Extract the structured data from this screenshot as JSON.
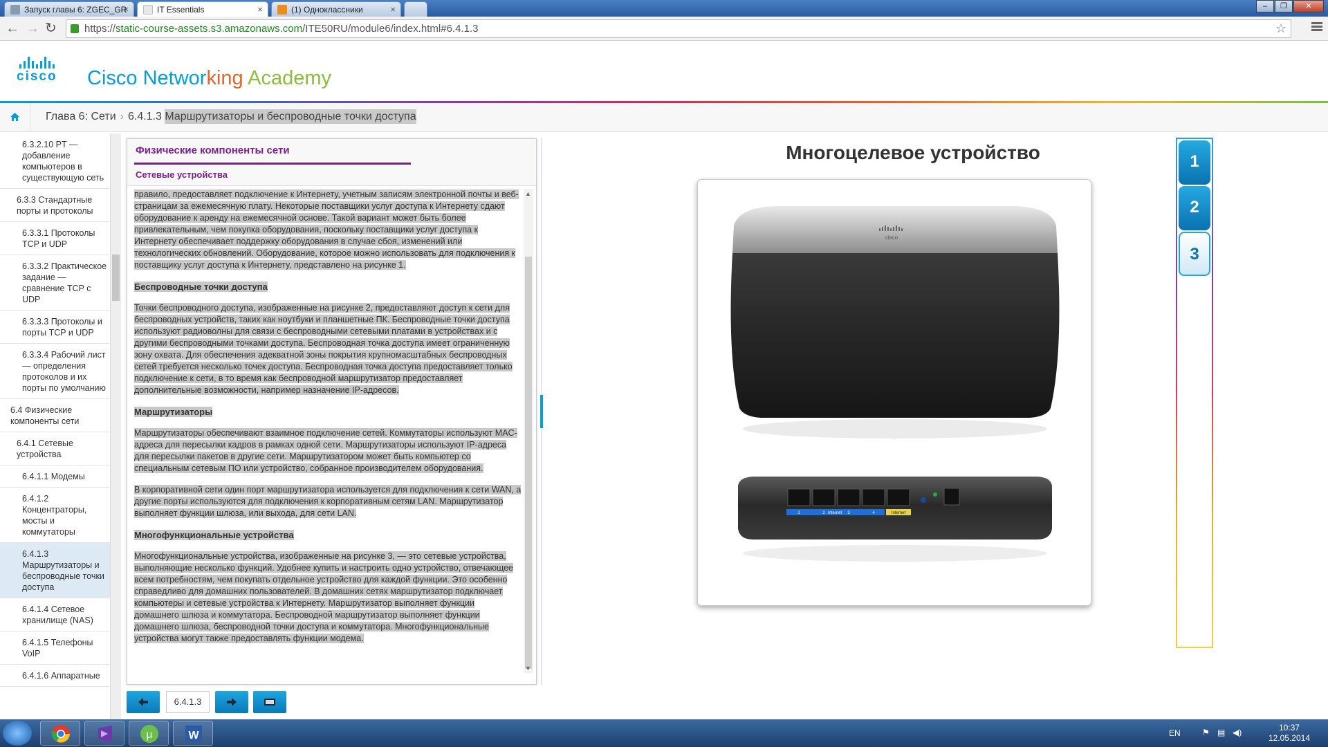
{
  "browser": {
    "tabs": [
      {
        "title": "Запуск главы 6: ZGEC_GR",
        "active": false
      },
      {
        "title": "IT Essentials",
        "active": true
      },
      {
        "title": "(1) Одноклассники",
        "active": false
      }
    ],
    "url_prefix": "https://",
    "url_host": "static-course-assets.s3.amazonaws.com",
    "url_path": "/ITE50RU/module6/index.html#6.4.1.3"
  },
  "header": {
    "logo_word": "cisco",
    "brand": {
      "p1": "Cisco Networ",
      "p2": "king",
      "p3": " Academy"
    }
  },
  "breadcrumb": {
    "chapter": "Глава 6: Сети",
    "page_num": "6.4.1.3",
    "page_title": "Маршрутизаторы и беспроводные точки доступа"
  },
  "toc": [
    {
      "label": "6.3.2.10 PT — добавление компьютеров в существующую сеть",
      "level": 3
    },
    {
      "label": "6.3.3 Стандартные порты и протоколы",
      "level": 2
    },
    {
      "label": "6.3.3.1 Протоколы TCP и UDP",
      "level": 3
    },
    {
      "label": "6.3.3.2 Практическое задание — сравнение TCP с UDP",
      "level": 3
    },
    {
      "label": "6.3.3.3 Протоколы и порты TCP и UDP",
      "level": 3
    },
    {
      "label": "6.3.3.4 Рабочий лист — определения протоколов и их порты по умолчанию",
      "level": 3
    },
    {
      "label": "6.4 Физические компоненты сети",
      "level": 1
    },
    {
      "label": "6.4.1 Сетевые устройства",
      "level": 2
    },
    {
      "label": "6.4.1.1 Модемы",
      "level": 3
    },
    {
      "label": "6.4.1.2 Концентраторы, мосты и коммутаторы",
      "level": 3
    },
    {
      "label": "6.4.1.3 Маршрутизаторы и беспроводные точки доступа",
      "level": 3,
      "active": true
    },
    {
      "label": "6.4.1.4 Сетевое хранилище (NAS)",
      "level": 3
    },
    {
      "label": "6.4.1.5 Телефоны VoIP",
      "level": 3
    },
    {
      "label": "6.4.1.6 Аппаратные",
      "level": 3
    }
  ],
  "panel": {
    "title": "Физические компоненты сети",
    "subtitle": "Сетевые устройства",
    "p1": "правило, предоставляет подключение к Интернету, учетным записям электронной почты и веб-страницам за ежемесячную плату. Некоторые поставщики услуг доступа к Интернету сдают оборудование к аренду на ежемесячной основе. Такой вариант может быть более привлекательным, чем покупка оборудования, поскольку поставщики услуг доступа к Интернету обеспечивает поддержку оборудования в случае сбоя, изменений или технологических обновлений. Оборудование, которое можно использовать для подключения к поставщику услуг доступа к Интернету, представлено на рисунке 1.",
    "h2": "Беспроводные точки доступа",
    "p2": "Точки беспроводного доступа, изображенные на рисунке 2, предоставляют доступ к сети для беспроводных устройств, таких как ноутбуки и планшетные ПК. Беспроводные точки доступа используют радиоволны для связи с беспроводными сетевыми платами в устройствах и с другими беспроводными точками доступа. Беспроводная точка доступа имеет ограниченную зону охвата. Для обеспечения адекватной зоны покрытия крупномасштабных беспроводных сетей требуется несколько точек доступа. Беспроводная точка доступа предоставляет только подключение к сети, в то время как беспроводной маршрутизатор предоставляет дополнительные возможности, например назначение IP-адресов.",
    "h3": "Маршрутизаторы",
    "p3": "Маршрутизаторы обеспечивают взаимное подключение сетей. Коммутаторы используют MAC-адреса для пересылки кадров в рамках одной сети. Маршрутизаторы используют IP-адреса для пересылки пакетов в другие сети. Маршрутизатором может быть компьютер со специальным сетевым ПО или устройство, собранное производителем оборудования.",
    "p4": "В корпоративной сети один порт маршрутизатора используется для подключения к сети WAN, а другие порты используются для подключения к корпоративным сетям LAN. Маршрутизатор выполняет функции шлюза, или выхода, для сети LAN.",
    "h4": "Многофункциональные устройства",
    "p5": "Многофункциональные устройства, изображенные на рисунке 3, — это сетевые устройства, выполняющие несколько функций. Удобнее купить и настроить одно устройство, отвечающее всем потребностям, чем покупать отдельное устройство для каждой функции. Это особенно справедливо для домашних пользователей. В домашних сетях маршрутизатор подключает компьютеры и сетевые устройства к Интернету. Маршрутизатор выполняет функции домашнего шлюза и коммутатора. Беспроводной маршрутизатор выполняет функции домашнего шлюза, беспроводной точки доступа и коммутатора. Многофункциональные устройства могут также предоставлять функции модема."
  },
  "pager": {
    "current": "6.4.1.3"
  },
  "media": {
    "title": "Многоцелевое устройство",
    "router_brand": "cisco",
    "port_labels": [
      "1",
      "2",
      "Internet",
      "3",
      "4",
      "Internet"
    ]
  },
  "figure_tabs": [
    "1",
    "2",
    "3"
  ],
  "figure_tab_selected": "3",
  "taskbar": {
    "lang": "EN",
    "time": "10:37",
    "date": "12.05.2014"
  },
  "colors": {
    "accent": "#049fd9",
    "purple": "#7a1f8f"
  }
}
